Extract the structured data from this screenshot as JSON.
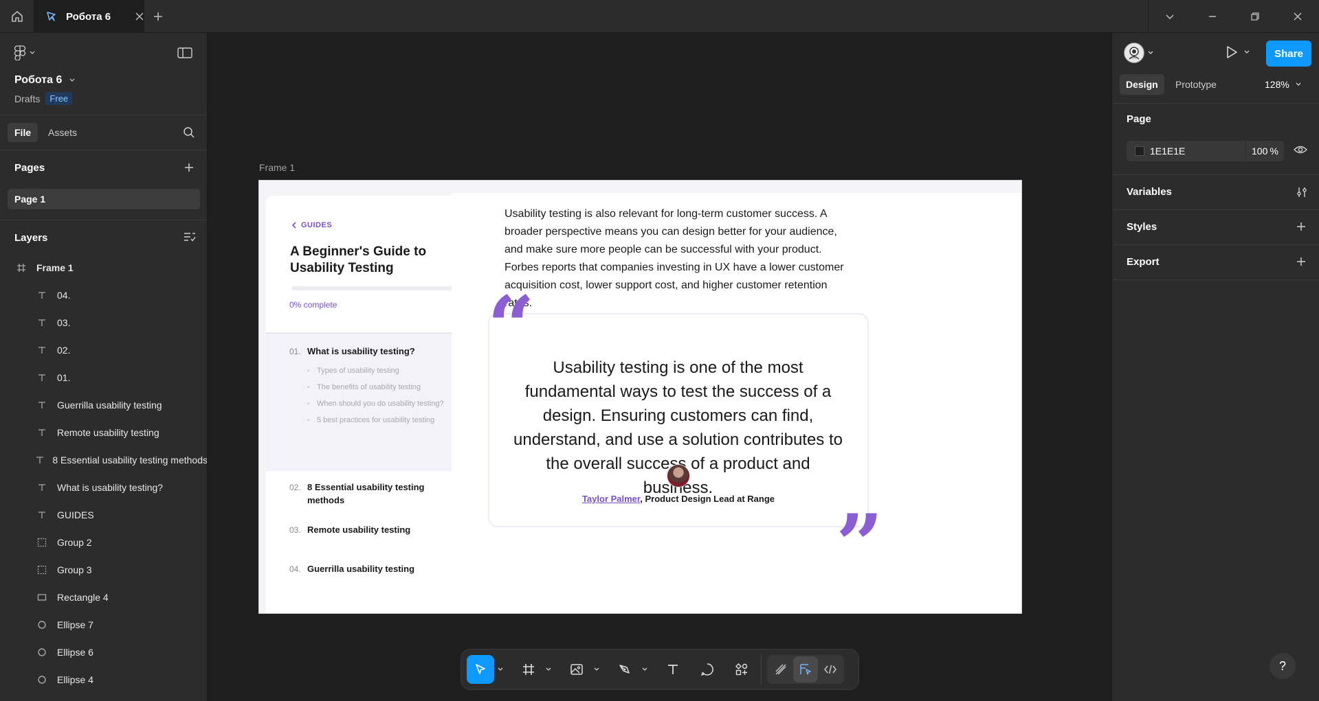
{
  "titlebar": {
    "tab_name": "Робота 6"
  },
  "left_panel": {
    "project_title": "Робота 6",
    "project_location": "Drafts",
    "plan_badge": "Free",
    "tabs": {
      "file": "File",
      "assets": "Assets"
    },
    "pages_heading": "Pages",
    "pages": [
      "Page 1"
    ],
    "layers_heading": "Layers",
    "layers": [
      {
        "name": "Frame 1",
        "type": "frame"
      },
      {
        "name": "04.",
        "type": "text"
      },
      {
        "name": "03.",
        "type": "text"
      },
      {
        "name": "02.",
        "type": "text"
      },
      {
        "name": "01.",
        "type": "text"
      },
      {
        "name": "Guerrilla usability testing",
        "type": "text"
      },
      {
        "name": "Remote usability testing",
        "type": "text"
      },
      {
        "name": "8 Essential usability testing methods",
        "type": "text"
      },
      {
        "name": "What is usability testing?",
        "type": "text"
      },
      {
        "name": "GUIDES",
        "type": "text"
      },
      {
        "name": "Group 2",
        "type": "group"
      },
      {
        "name": "Group 3",
        "type": "group"
      },
      {
        "name": "Rectangle 4",
        "type": "rect"
      },
      {
        "name": "Ellipse 7",
        "type": "ellipse"
      },
      {
        "name": "Ellipse 6",
        "type": "ellipse"
      },
      {
        "name": "Ellipse 4",
        "type": "ellipse"
      }
    ]
  },
  "canvas": {
    "frame_label": "Frame 1",
    "guide": {
      "back_link": "GUIDES",
      "title": "A Beginner's Guide to Usability Testing",
      "progress_percent": 0,
      "progress_text": "0% complete",
      "sections": [
        {
          "num": "01.",
          "title": "What is usability testing?",
          "active": true,
          "subitems": [
            "Types of usability testing",
            "The benefits of usability testing",
            "When should you do usability testing?",
            "5 best practices for usability testing"
          ]
        },
        {
          "num": "02.",
          "title": "8 Essential usability testing methods",
          "active": false
        },
        {
          "num": "03.",
          "title": "Remote usability testing",
          "active": false
        },
        {
          "num": "04.",
          "title": "Guerrilla usability testing",
          "active": false
        }
      ]
    },
    "article": {
      "paragraph": "Usability testing is also relevant for long-term customer success. A broader perspective means you can design better for your audience, and make sure more people can be successful with your product. Forbes reports that companies investing in UX have a lower customer acquisition cost, lower support cost, and higher customer retention rates.",
      "quote": "Usability testing is one of the most fundamental ways to test the success of a design. Ensuring customers can find, understand, and use a solution contributes to the overall success of a product and business.",
      "author": "Taylor Palmer",
      "author_role": ", Product Design Lead at Range"
    }
  },
  "right_panel": {
    "share_label": "Share",
    "tabs": {
      "design": "Design",
      "prototype": "Prototype"
    },
    "zoom": "128%",
    "page_heading": "Page",
    "page_color": "1E1E1E",
    "page_opacity": "100",
    "opacity_unit": "%",
    "variables_heading": "Variables",
    "styles_heading": "Styles",
    "export_heading": "Export",
    "help": "?"
  },
  "colors": {
    "accent_blue": "#0d99ff",
    "brand_purple": "#8b5fd3",
    "panel_bg": "#2c2c2c",
    "canvas_bg": "#1e1e1e"
  }
}
